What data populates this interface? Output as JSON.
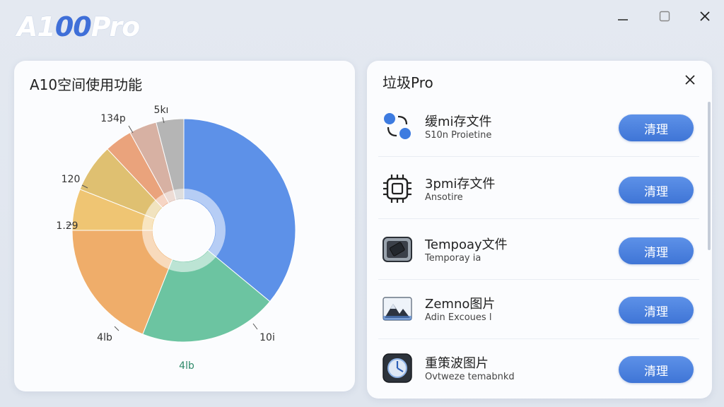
{
  "app": {
    "logo_a": "A1",
    "logo_b": "00",
    "logo_c": "Pro"
  },
  "window": {
    "min_icon": "minimize-icon",
    "max_icon": "maximize-icon",
    "close_icon": "close-icon"
  },
  "left_panel": {
    "title": "A10空间使用功能"
  },
  "right_panel": {
    "title": "垃圾Pro",
    "close_icon": "close-icon",
    "items": [
      {
        "title": "缓mi存文件",
        "subtitle": "S10n Proietine",
        "button": "清理",
        "icon": "connect-nodes-icon"
      },
      {
        "title": "3pmi存文件",
        "subtitle": "Ansotire",
        "button": "清理",
        "icon": "chip-icon"
      },
      {
        "title": "Tempoay文件",
        "subtitle": "Temporay ia",
        "button": "清理",
        "icon": "ssd-drive-icon"
      },
      {
        "title": "Zemno图片",
        "subtitle": "Adin Excoues l",
        "button": "清理",
        "icon": "image-mountain-icon"
      },
      {
        "title": "重策波图片",
        "subtitle": "Ovtweze temabnkd",
        "button": "清理",
        "icon": "clock-app-icon"
      }
    ]
  },
  "chart_data": {
    "type": "pie",
    "donut": true,
    "title": "",
    "slices": [
      {
        "label": "",
        "value": 36,
        "color": "#4d86e6"
      },
      {
        "label": "4lb",
        "value": 20,
        "color": "#5dbf98"
      },
      {
        "label": "4lb",
        "value": 19,
        "color": "#eea55a"
      },
      {
        "label": "1.29",
        "value": 6,
        "color": "#eec065"
      },
      {
        "label": "120",
        "value": 7,
        "color": "#dcba62"
      },
      {
        "label": "",
        "value": 4,
        "color": "#e99a6e"
      },
      {
        "label": "134p",
        "value": 4,
        "color": "#d4a99a"
      },
      {
        "label": "5kı",
        "value": 4,
        "color": "#aeaeae"
      }
    ],
    "outer_labels": [
      "5kı",
      "134p",
      "120",
      "1.29",
      "4lb",
      "4lb",
      "10i"
    ]
  }
}
